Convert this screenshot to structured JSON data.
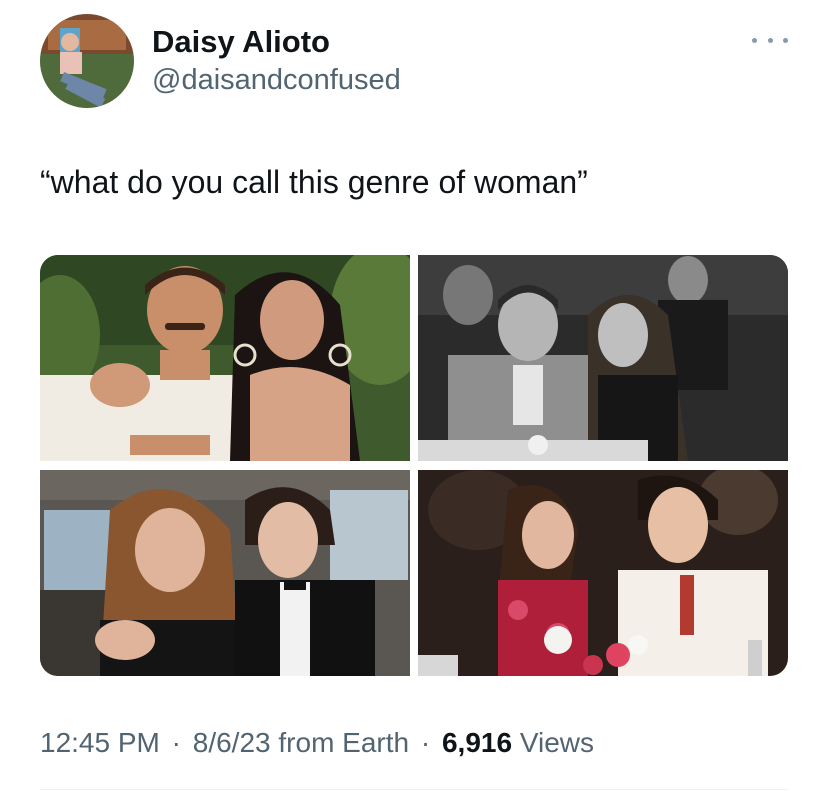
{
  "author": {
    "display_name": "Daisy Alioto",
    "handle": "@daisandconfused",
    "avatar_icon": "user-avatar-photo"
  },
  "more_icon": "more-horizontal-icon",
  "tweet": {
    "text": "“what do you call this genre of woman”"
  },
  "media": {
    "count": 4,
    "photos": [
      {
        "icon": "photo-couple-1",
        "style": "color"
      },
      {
        "icon": "photo-couple-2",
        "style": "black-and-white"
      },
      {
        "icon": "photo-couple-3",
        "style": "color"
      },
      {
        "icon": "photo-couple-4",
        "style": "color"
      }
    ]
  },
  "meta": {
    "time": "12:45 PM",
    "sep1": "·",
    "date": "8/6/23",
    "source": "from Earth",
    "sep2": "·",
    "views_count": "6,916",
    "views_label": "Views"
  },
  "colors": {
    "text_primary": "#0f1419",
    "text_secondary": "#536471",
    "divider": "#eff3f4",
    "background": "#ffffff"
  }
}
